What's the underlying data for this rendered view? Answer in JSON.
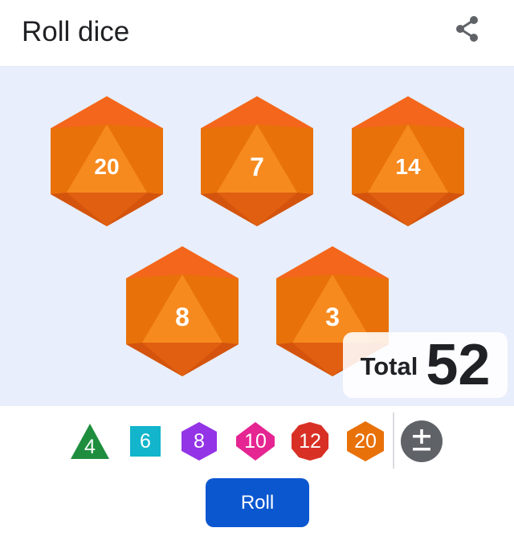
{
  "header": {
    "title": "Roll dice",
    "share_icon": "share-icon"
  },
  "dice": [
    {
      "sides": 20,
      "value": "20"
    },
    {
      "sides": 20,
      "value": "7"
    },
    {
      "sides": 20,
      "value": "14"
    },
    {
      "sides": 20,
      "value": "8"
    },
    {
      "sides": 20,
      "value": "3"
    }
  ],
  "total": {
    "label": "Total",
    "value": "52"
  },
  "picker": [
    {
      "label": "4",
      "shape": "triangle",
      "color": "#1e8e3e"
    },
    {
      "label": "6",
      "shape": "square",
      "color": "#12b5cb"
    },
    {
      "label": "8",
      "shape": "hexagon",
      "color": "#9334e6"
    },
    {
      "label": "10",
      "shape": "hexagon",
      "color": "#e52592"
    },
    {
      "label": "12",
      "shape": "decagon",
      "color": "#d93025"
    },
    {
      "label": "20",
      "shape": "hexagon",
      "color": "#e8710a"
    }
  ],
  "modifier_icon": "plus-minus-icon",
  "roll_button": {
    "label": "Roll"
  },
  "colors": {
    "tray": "#e8eefb",
    "die_base": "#e8710a",
    "die_light": "#f68a1f",
    "die_dark": "#d4540e",
    "roll": "#0b57d0"
  }
}
